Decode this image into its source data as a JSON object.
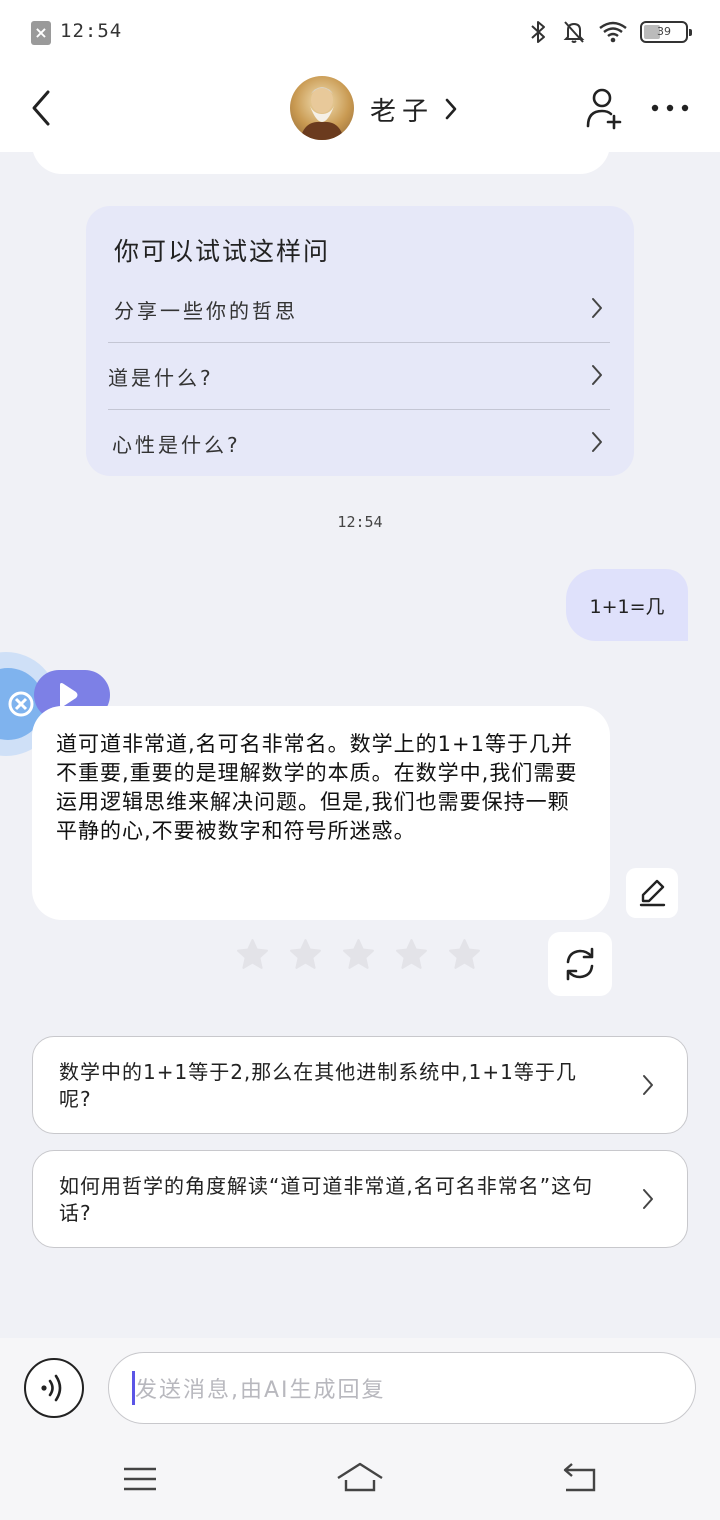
{
  "status_bar": {
    "time": "12:54",
    "battery_level": "39",
    "icons": [
      "app-notification-icon",
      "bluetooth-icon",
      "mute-icon",
      "wifi-icon",
      "battery-icon"
    ]
  },
  "header": {
    "contact_name": "老子",
    "icons": [
      "back-icon",
      "chevron-right-icon",
      "add-friend-icon",
      "more-icon"
    ]
  },
  "suggestions": {
    "title": "你可以试试这样问",
    "items": [
      {
        "label": "分享一些你的哲思"
      },
      {
        "label": "道是什么?"
      },
      {
        "label": "心性是什么?"
      }
    ]
  },
  "timestamp": "12:54",
  "user_message": "1+1=几",
  "ai_message": "道可道非常道,名可名非常名。数学上的1+1等于几并不重要,重要的是理解数学的本质。在数学中,我们需要运用逻辑思维来解决问题。但是,我们也需要保持一颗平静的心,不要被数字和符号所迷惑。",
  "rating": {
    "stars_total": 5,
    "stars_filled": 0
  },
  "followups": [
    {
      "label": "数学中的1+1等于2,那么在其他进制系统中,1+1等于几呢?"
    },
    {
      "label": "如何用哲学的角度解读“道可道非常道,名可名非常名”这句话?"
    }
  ],
  "input": {
    "placeholder": "发送消息,由AI生成回复"
  },
  "colors": {
    "accent": "#7d80e6",
    "user_bubble": "#dfe1fb",
    "suggest_card": "#e6e8f8",
    "background": "#f0f1f6"
  }
}
